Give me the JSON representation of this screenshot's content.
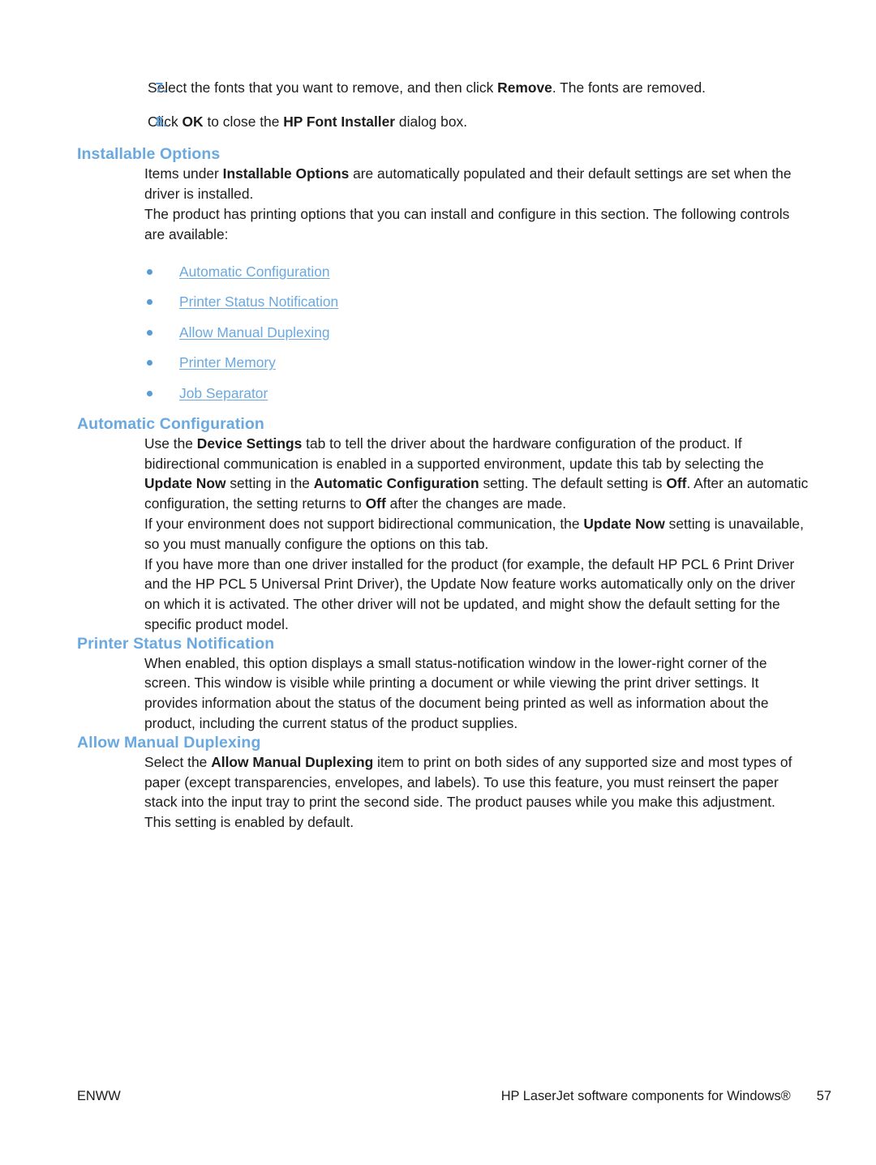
{
  "colors": {
    "heading_blue": "#6aa8e0",
    "link_blue": "#6aa8e0",
    "number_blue": "#5b9bd5",
    "body_text": "#1c1c1c",
    "page_background": "#ffffff"
  },
  "steps": [
    {
      "number": "7.",
      "parts": [
        {
          "text": "Select the fonts that you want to remove, and then click ",
          "bold": false
        },
        {
          "text": "Remove",
          "bold": true
        },
        {
          "text": ". The fonts are removed.",
          "bold": false
        }
      ],
      "plain": "Select the fonts that you want to remove, and then click Remove. The fonts are removed."
    },
    {
      "number": "8.",
      "parts": [
        {
          "text": "Click ",
          "bold": false
        },
        {
          "text": "OK",
          "bold": true
        },
        {
          "text": " to close the ",
          "bold": false
        },
        {
          "text": "HP Font Installer",
          "bold": true
        },
        {
          "text": " dialog box.",
          "bold": false
        }
      ],
      "plain": "Click OK to close the HP Font Installer dialog box."
    }
  ],
  "sections": [
    {
      "id": "installable-options",
      "heading": "Installable Options",
      "paragraphs": [
        {
          "parts": [
            {
              "text": "Items under ",
              "bold": false
            },
            {
              "text": "Installable Options",
              "bold": true
            },
            {
              "text": " are automatically populated and their default settings are set when the driver is installed.",
              "bold": false
            }
          ],
          "plain": "Items under Installable Options are automatically populated and their default settings are set when the driver is installed."
        },
        {
          "parts": [
            {
              "text": "The product has printing options that you can install and configure in this section. The following controls are available:",
              "bold": false
            }
          ],
          "plain": "The product has printing options that you can install and configure in this section. The following controls are available:"
        }
      ],
      "links": [
        "Automatic Configuration",
        "Printer Status Notification",
        "Allow Manual Duplexing",
        "Printer Memory",
        "Job Separator"
      ]
    },
    {
      "id": "automatic-configuration",
      "heading": "Automatic Configuration",
      "paragraphs": [
        {
          "parts": [
            {
              "text": "Use the ",
              "bold": false
            },
            {
              "text": "Device Settings",
              "bold": true
            },
            {
              "text": " tab to tell the driver about the hardware configuration of the product. If bidirectional communication is enabled in a supported environment, update this tab by selecting the ",
              "bold": false
            },
            {
              "text": "Update Now",
              "bold": true
            },
            {
              "text": " setting in the ",
              "bold": false
            },
            {
              "text": "Automatic Configuration",
              "bold": true
            },
            {
              "text": " setting. The default setting is ",
              "bold": false
            },
            {
              "text": "Off",
              "bold": true
            },
            {
              "text": ". After an automatic configuration, the setting returns to ",
              "bold": false
            },
            {
              "text": "Off",
              "bold": true
            },
            {
              "text": " after the changes are made.",
              "bold": false
            }
          ],
          "plain": "Use the Device Settings tab to tell the driver about the hardware configuration of the product. If bidirectional communication is enabled in a supported environment, update this tab by selecting the Update Now setting in the Automatic Configuration setting. The default setting is Off. After an automatic configuration, the setting returns to Off after the changes are made."
        },
        {
          "parts": [
            {
              "text": "If your environment does not support bidirectional communication, the ",
              "bold": false
            },
            {
              "text": "Update Now",
              "bold": true
            },
            {
              "text": " setting is unavailable, so you must manually configure the options on this tab.",
              "bold": false
            }
          ],
          "plain": "If your environment does not support bidirectional communication, the Update Now setting is unavailable, so you must manually configure the options on this tab."
        },
        {
          "parts": [
            {
              "text": "If you have more than one driver installed for the product (for example, the default HP PCL 6 Print Driver and the HP PCL 5 Universal Print Driver), the Update Now feature works automatically only on the driver on which it is activated. The other driver will not be updated, and might show the default setting for the specific product model.",
              "bold": false
            }
          ],
          "plain": "If you have more than one driver installed for the product (for example, the default HP PCL 6 Print Driver and the HP PCL 5 Universal Print Driver), the Update Now feature works automatically only on the driver on which it is activated. The other driver will not be updated, and might show the default setting for the specific product model."
        }
      ]
    },
    {
      "id": "printer-status-notification",
      "heading": "Printer Status Notification",
      "paragraphs": [
        {
          "parts": [
            {
              "text": "When enabled, this option displays a small status-notification window in the lower-right corner of the screen. This window is visible while printing a document or while viewing the print driver settings. It provides information about the status of the document being printed as well as information about the product, including the current status of the product supplies.",
              "bold": false
            }
          ],
          "plain": "When enabled, this option displays a small status-notification window in the lower-right corner of the screen. This window is visible while printing a document or while viewing the print driver settings. It provides information about the status of the document being printed as well as information about the product, including the current status of the product supplies."
        }
      ]
    },
    {
      "id": "allow-manual-duplexing",
      "heading": "Allow Manual Duplexing",
      "paragraphs": [
        {
          "parts": [
            {
              "text": "Select the ",
              "bold": false
            },
            {
              "text": "Allow Manual Duplexing",
              "bold": true
            },
            {
              "text": " item to print on both sides of any supported size and most types of paper (except transparencies, envelopes, and labels). To use this feature, you must reinsert the paper stack into the input tray to print the second side. The product pauses while you make this adjustment.",
              "bold": false
            }
          ],
          "plain": "Select the Allow Manual Duplexing item to print on both sides of any supported size and most types of paper (except transparencies, envelopes, and labels). To use this feature, you must reinsert the paper stack into the input tray to print the second side. The product pauses while you make this adjustment."
        },
        {
          "parts": [
            {
              "text": "This setting is enabled by default.",
              "bold": false
            }
          ],
          "plain": "This setting is enabled by default."
        }
      ]
    }
  ],
  "footer": {
    "left": "ENWW",
    "doc_title": "HP LaserJet software components for Windows®",
    "page_number": "57"
  }
}
